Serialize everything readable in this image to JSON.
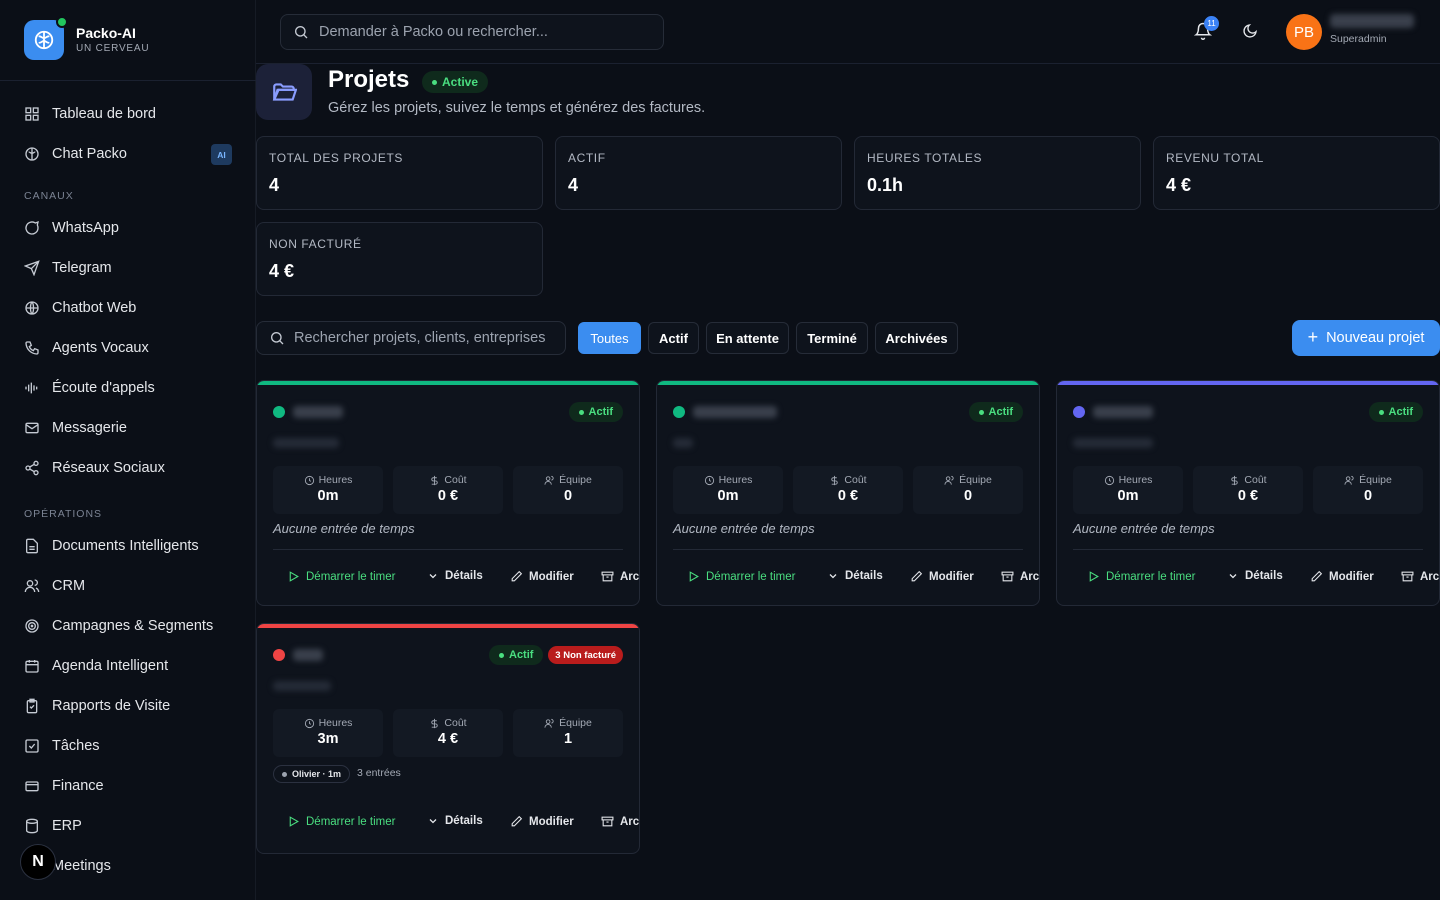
{
  "brand": {
    "name": "Packo-AI",
    "tagline": "UN CERVEAU"
  },
  "sidebar": {
    "top_items": [
      {
        "label": "Tableau de bord",
        "icon": "dashboard-icon"
      },
      {
        "label": "Chat Packo",
        "icon": "brain-icon",
        "badge": "AI"
      }
    ],
    "sections": [
      {
        "title": "CANAUX",
        "items": [
          {
            "label": "WhatsApp"
          },
          {
            "label": "Telegram"
          },
          {
            "label": "Chatbot Web"
          },
          {
            "label": "Agents Vocaux"
          },
          {
            "label": "Écoute d'appels"
          },
          {
            "label": "Messagerie"
          },
          {
            "label": "Réseaux Sociaux"
          }
        ]
      },
      {
        "title": "OPÉRATIONS",
        "items": [
          {
            "label": "Documents Intelligents"
          },
          {
            "label": "CRM"
          },
          {
            "label": "Campagnes & Segments"
          },
          {
            "label": "Agenda Intelligent"
          },
          {
            "label": "Rapports de Visite"
          },
          {
            "label": "Tâches"
          },
          {
            "label": "Finance"
          },
          {
            "label": "ERP"
          },
          {
            "label": "Meetings"
          }
        ]
      }
    ],
    "assistant_bubble": "N"
  },
  "topbar": {
    "search_placeholder": "Demander à Packo ou rechercher...",
    "notification_count": "11",
    "avatar_initials": "PB",
    "user_role": "Superadmin"
  },
  "header": {
    "title": "Projets",
    "status": "Active",
    "subtitle": "Gérez les projets, suivez le temps et générez des factures."
  },
  "stats": [
    {
      "label": "TOTAL DES PROJETS",
      "value": "4"
    },
    {
      "label": "ACTIF",
      "value": "4"
    },
    {
      "label": "HEURES TOTALES",
      "value": "0.1h"
    },
    {
      "label": "REVENU TOTAL",
      "value": "4 €"
    },
    {
      "label": "NON FACTURÉ",
      "value": "4 €"
    }
  ],
  "filters": {
    "search_placeholder": "Rechercher projets, clients, entreprises",
    "tabs": [
      "Toutes",
      "Actif",
      "En attente",
      "Terminé",
      "Archivées"
    ],
    "active_tab": "Toutes",
    "new_button": "Nouveau projet"
  },
  "card_labels": {
    "hours": "Heures",
    "cost": "Coût",
    "team": "Équipe",
    "no_entries": "Aucune entrée de temps",
    "start_timer": "Démarrer le timer",
    "details": "Détails",
    "edit": "Modifier",
    "archive": "Arc"
  },
  "projects": [
    {
      "color": "#10b981",
      "status": "Actif",
      "hours": "0m",
      "cost": "0 €",
      "team": "0"
    },
    {
      "color": "#10b981",
      "status": "Actif",
      "hours": "0m",
      "cost": "0 €",
      "team": "0"
    },
    {
      "color": "#6366f1",
      "status": "Actif",
      "hours": "0m",
      "cost": "0 €",
      "team": "0"
    },
    {
      "color": "#ef4444",
      "status": "Actif",
      "unbilled": "3 Non facturé",
      "hours": "3m",
      "cost": "4 €",
      "team": "1",
      "user_chip": "Olivier · 1m",
      "entries": "3 entrées"
    }
  ],
  "colors": {
    "accent": "#3b8df0",
    "success": "#4ade80",
    "danger": "#b91c1c"
  }
}
